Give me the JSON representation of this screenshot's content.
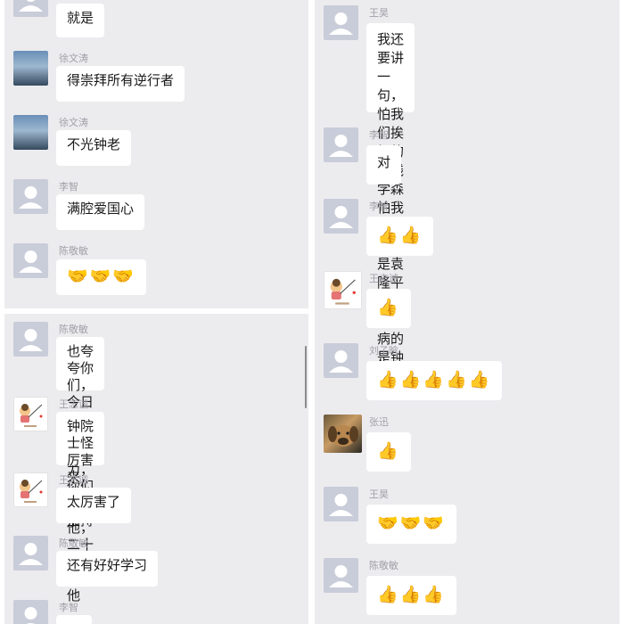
{
  "panels": [
    {
      "messages": [
        {
          "sender": "",
          "avatar": "default",
          "text": "就是"
        },
        {
          "sender": "徐文涛",
          "avatar": "photo-person",
          "text": "得崇拜所有逆行者"
        },
        {
          "sender": "徐文涛",
          "avatar": "photo-person",
          "text": "不光钟老"
        },
        {
          "sender": "李智",
          "avatar": "default",
          "text": "满腔爱国心"
        },
        {
          "sender": "陈敬敏",
          "avatar": "default",
          "text": "🤝🤝🤝"
        }
      ]
    },
    {
      "messages": [
        {
          "sender": "陈敬敏",
          "avatar": "default",
          "text": "也夸夸你们，今日校园继续努\n力，你们也在坚持"
        },
        {
          "sender": "王志诚",
          "avatar": "cartoon",
          "text": "钟院士怪厉害来，非典就有\n他，二十年了还靠他"
        },
        {
          "sender": "王志诚",
          "avatar": "cartoon",
          "text": "太厉害了"
        },
        {
          "sender": "陈敬敏",
          "avatar": "default",
          "text": "还有好好学习"
        },
        {
          "sender": "李智",
          "avatar": "default",
          "text": ""
        }
      ]
    },
    {
      "messages": [
        {
          "sender": "王昊",
          "avatar": "default",
          "text": "我还要讲一句，怕我们挨打的\n是钱学森\n怕我们饿着的是袁隆平\n怕我们生病的是钟南山"
        },
        {
          "sender": "李智",
          "avatar": "default",
          "text": "对"
        },
        {
          "sender": "李智",
          "avatar": "default",
          "text": "👍👍"
        },
        {
          "sender": "王志诚",
          "avatar": "cartoon",
          "text": "👍"
        },
        {
          "sender": "刘子晗",
          "avatar": "default",
          "text": "👍👍👍👍👍"
        },
        {
          "sender": "张迅",
          "avatar": "dog",
          "text": "👍"
        },
        {
          "sender": "王昊",
          "avatar": "default",
          "text": "🤝🤝🤝"
        },
        {
          "sender": "陈敬敏",
          "avatar": "default",
          "text": "👍👍👍"
        }
      ]
    }
  ]
}
